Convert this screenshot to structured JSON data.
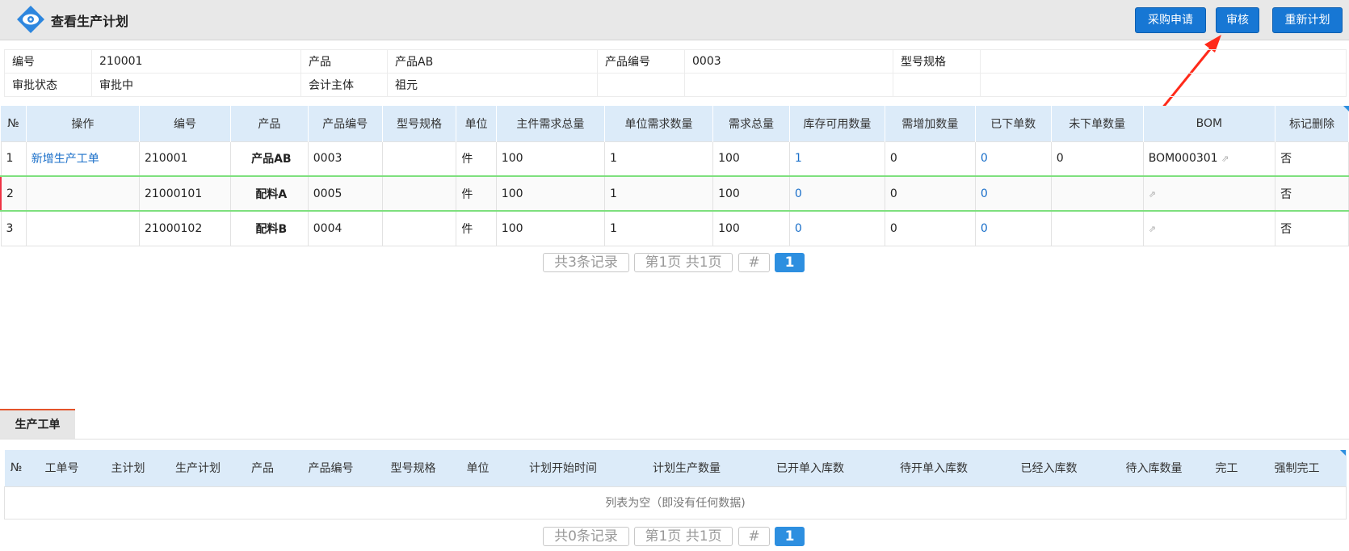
{
  "header": {
    "title": "查看生产计划"
  },
  "buttons": {
    "purchase": "采购申请",
    "audit": "审核",
    "replan": "重新计划"
  },
  "info": {
    "r1": {
      "l1": "编号",
      "v1": "210001",
      "l2": "产品",
      "v2": "产品AB",
      "l3": "产品编号",
      "v3": "0003",
      "l4": "型号规格",
      "v4": ""
    },
    "r2": {
      "l1": "审批状态",
      "v1": "审批中",
      "l2": "会计主体",
      "v2": "祖元"
    }
  },
  "grid": {
    "columns": [
      "№",
      "操作",
      "编号",
      "产品",
      "产品编号",
      "型号规格",
      "单位",
      "主件需求总量",
      "单位需求数量",
      "需求总量",
      "库存可用数量",
      "需增加数量",
      "已下单数",
      "未下单数量",
      "BOM",
      "标记删除"
    ],
    "rows": [
      {
        "n": "1",
        "op": "新增生产工单",
        "code": "210001",
        "prod": "产品AB",
        "pcode": "0003",
        "spec": "",
        "unit": "件",
        "main": "100",
        "unitq": "1",
        "total": "100",
        "avail": "1",
        "add": "0",
        "ordered": "0",
        "unord": "0",
        "bom": "BOM000301",
        "del": "否"
      },
      {
        "n": "2",
        "op": "",
        "code": "21000101",
        "prod": "配料A",
        "pcode": "0005",
        "spec": "",
        "unit": "件",
        "main": "100",
        "unitq": "1",
        "total": "100",
        "avail": "0",
        "add": "0",
        "ordered": "0",
        "unord": "",
        "bom": "",
        "del": "否"
      },
      {
        "n": "3",
        "op": "",
        "code": "21000102",
        "prod": "配料B",
        "pcode": "0004",
        "spec": "",
        "unit": "件",
        "main": "100",
        "unitq": "1",
        "total": "100",
        "avail": "0",
        "add": "0",
        "ordered": "0",
        "unord": "",
        "bom": "",
        "del": "否"
      }
    ]
  },
  "pager1": {
    "records": "共3条记录",
    "pages": "第1页 共1页",
    "jump": "#",
    "current": "1"
  },
  "tab": {
    "label": "生产工单"
  },
  "grid2": {
    "columns": [
      "№",
      "工单号",
      "主计划",
      "生产计划",
      "产品",
      "产品编号",
      "型号规格",
      "单位",
      "计划开始时间",
      "计划生产数量",
      "已开单入库数",
      "待开单入库数",
      "已经入库数",
      "待入库数量",
      "完工",
      "强制完工"
    ],
    "empty": "列表为空（即没有任何数据)"
  },
  "pager2": {
    "records": "共0条记录",
    "pages": "第1页 共1页",
    "jump": "#",
    "current": "1"
  },
  "colors": {
    "accent": "#1777d4",
    "header_bg": "#dcebf9",
    "link": "#1a6fc9",
    "tab_border": "#e4542a",
    "annotation_arrow": "#ff2a1a"
  }
}
